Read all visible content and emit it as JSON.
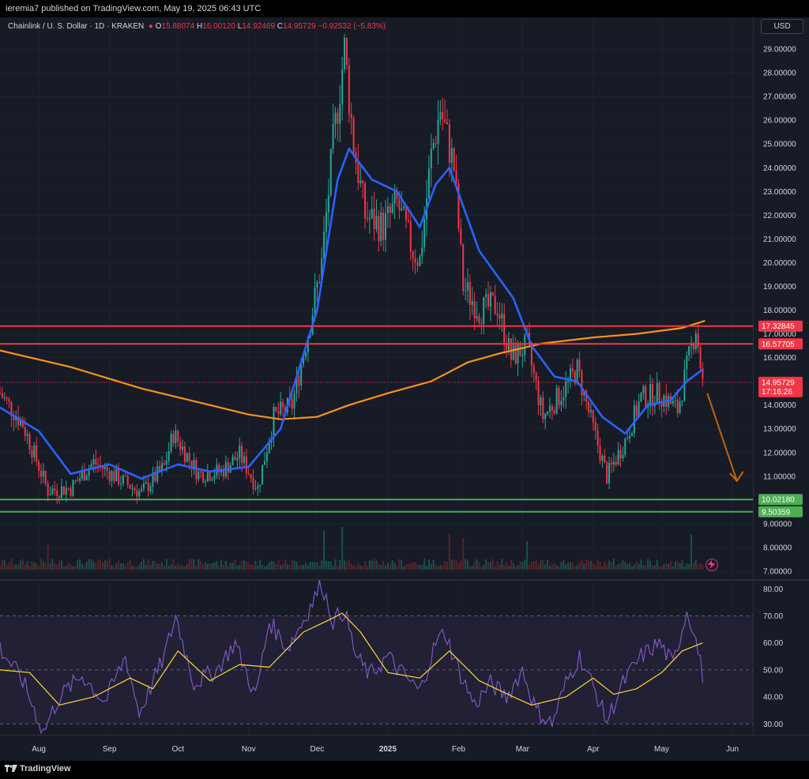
{
  "header": {
    "published": "ieremia7 published on TradingView.com, May 19, 2025 06:43 UTC"
  },
  "symbol_legend": {
    "name": "Chainlink / U. S. Dollar · 1D · KRAKEN",
    "open_label": "O",
    "open": "15.88074",
    "high_label": "H",
    "high": "16.00120",
    "low_label": "L",
    "low": "14.92469",
    "close_label": "C",
    "close": "14.95729",
    "change": "−0.92532 (−5.83%)"
  },
  "currency_button": "USD",
  "footer": {
    "brand": "TradingView"
  },
  "colors": {
    "bull": "#26a69a",
    "bear": "#f23645",
    "ema_fast": "#2962ff",
    "ema_slow": "#f7931a",
    "resistance": "#f23645",
    "support": "#4caf50",
    "rsi": "#7e57c2",
    "rsi_ma": "#fdd835",
    "arrow": "#c0650a"
  },
  "chart_data": [
    {
      "type": "candlestick",
      "title": "Chainlink / U. S. Dollar · 1D · KRAKEN",
      "ylim": [
        7.0,
        30.0
      ],
      "y_ticks": [
        "29.00000",
        "28.00000",
        "27.00000",
        "26.00000",
        "25.00000",
        "24.00000",
        "23.00000",
        "22.00000",
        "21.00000",
        "20.00000",
        "19.00000",
        "18.00000",
        "17.00000",
        "16.00000",
        "14.00000",
        "13.00000",
        "12.00000",
        "11.00000",
        "9.00000",
        "8.00000",
        "7.00000"
      ],
      "x_ticks": [
        "Aug",
        "Sep",
        "Oct",
        "Nov",
        "Dec",
        "2025",
        "Feb",
        "Mar",
        "Apr",
        "May",
        "Jun"
      ],
      "x_tick_dates": [
        "2024-08-01",
        "2024-09-01",
        "2024-10-01",
        "2024-11-01",
        "2024-12-01",
        "2025-01-01",
        "2025-02-01",
        "2025-03-01",
        "2025-04-01",
        "2025-05-01",
        "2025-06-01"
      ],
      "x_range": [
        "2024-07-15",
        "2025-06-10"
      ],
      "price_path": [
        [
          "2024-07-15",
          14.5
        ],
        [
          "2024-07-25",
          13.2
        ],
        [
          "2024-08-05",
          10.4
        ],
        [
          "2024-08-15",
          10.5
        ],
        [
          "2024-08-25",
          11.6
        ],
        [
          "2024-09-05",
          10.9
        ],
        [
          "2024-09-15",
          10.3
        ],
        [
          "2024-09-25",
          11.4
        ],
        [
          "2024-09-29",
          12.8
        ],
        [
          "2024-10-10",
          11.1
        ],
        [
          "2024-10-20",
          11.2
        ],
        [
          "2024-10-28",
          11.9
        ],
        [
          "2024-11-05",
          10.5
        ],
        [
          "2024-11-12",
          13.5
        ],
        [
          "2024-11-20",
          14.0
        ],
        [
          "2024-11-28",
          17.5
        ],
        [
          "2024-12-03",
          20.0
        ],
        [
          "2024-12-08",
          25.0
        ],
        [
          "2024-12-13",
          29.0
        ],
        [
          "2024-12-17",
          25.0
        ],
        [
          "2024-12-22",
          22.0
        ],
        [
          "2024-12-30",
          21.5
        ],
        [
          "2025-01-05",
          22.5
        ],
        [
          "2025-01-12",
          20.5
        ],
        [
          "2025-01-15",
          20.1
        ],
        [
          "2025-01-20",
          24.5
        ],
        [
          "2025-01-24",
          26.5
        ],
        [
          "2025-01-30",
          24.0
        ],
        [
          "2025-02-03",
          19.0
        ],
        [
          "2025-02-10",
          18.0
        ],
        [
          "2025-02-18",
          18.2
        ],
        [
          "2025-02-24",
          16.0
        ],
        [
          "2025-03-03",
          16.5
        ],
        [
          "2025-03-10",
          13.5
        ],
        [
          "2025-03-18",
          14.5
        ],
        [
          "2025-03-25",
          15.5
        ],
        [
          "2025-04-01",
          13.0
        ],
        [
          "2025-04-07",
          11.0
        ],
        [
          "2025-04-15",
          12.5
        ],
        [
          "2025-04-22",
          14.3
        ],
        [
          "2025-04-30",
          14.5
        ],
        [
          "2025-05-08",
          13.8
        ],
        [
          "2025-05-13",
          16.0
        ],
        [
          "2025-05-16",
          17.3
        ],
        [
          "2025-05-19",
          14.95
        ]
      ],
      "ema_fast_path": [
        [
          "2024-07-15",
          13.9
        ],
        [
          "2024-08-01",
          12.9
        ],
        [
          "2024-08-15",
          11.1
        ],
        [
          "2024-09-01",
          11.5
        ],
        [
          "2024-09-15",
          10.9
        ],
        [
          "2024-10-01",
          11.5
        ],
        [
          "2024-10-15",
          11.2
        ],
        [
          "2024-11-01",
          11.4
        ],
        [
          "2024-11-15",
          13.0
        ],
        [
          "2024-12-01",
          18.0
        ],
        [
          "2024-12-10",
          23.5
        ],
        [
          "2024-12-15",
          24.8
        ],
        [
          "2024-12-25",
          23.5
        ],
        [
          "2025-01-05",
          23.0
        ],
        [
          "2025-01-15",
          21.5
        ],
        [
          "2025-01-22",
          23.3
        ],
        [
          "2025-01-28",
          24.0
        ],
        [
          "2025-02-10",
          20.5
        ],
        [
          "2025-02-25",
          18.5
        ],
        [
          "2025-03-05",
          16.5
        ],
        [
          "2025-03-15",
          15.2
        ],
        [
          "2025-03-25",
          15.0
        ],
        [
          "2025-04-05",
          13.5
        ],
        [
          "2025-04-15",
          12.8
        ],
        [
          "2025-04-25",
          14.0
        ],
        [
          "2025-05-05",
          14.2
        ],
        [
          "2025-05-12",
          15.0
        ],
        [
          "2025-05-19",
          15.5
        ]
      ],
      "ema_slow_path": [
        [
          "2024-07-15",
          16.3
        ],
        [
          "2024-08-15",
          15.6
        ],
        [
          "2024-09-15",
          14.7
        ],
        [
          "2024-10-15",
          14.0
        ],
        [
          "2024-11-01",
          13.6
        ],
        [
          "2024-11-15",
          13.4
        ],
        [
          "2024-12-01",
          13.5
        ],
        [
          "2024-12-15",
          14.0
        ],
        [
          "2025-01-01",
          14.5
        ],
        [
          "2025-01-20",
          15.0
        ],
        [
          "2025-02-05",
          15.8
        ],
        [
          "2025-02-20",
          16.2
        ],
        [
          "2025-03-10",
          16.6
        ],
        [
          "2025-04-01",
          16.85
        ],
        [
          "2025-04-20",
          17.0
        ],
        [
          "2025-05-10",
          17.25
        ],
        [
          "2025-05-20",
          17.55
        ]
      ],
      "horizontal_levels": [
        {
          "label": "17.32845",
          "value": 17.32845,
          "kind": "resistance"
        },
        {
          "label": "16.57705",
          "value": 16.57705,
          "kind": "resistance"
        },
        {
          "label": "10.02180",
          "value": 10.0218,
          "kind": "support"
        },
        {
          "label": "9.50359",
          "value": 9.50359,
          "kind": "support"
        }
      ],
      "last_price": {
        "label": "14.95729",
        "countdown": "17:16:26",
        "value": 14.95729
      },
      "arrow": {
        "from": [
          "2025-05-21",
          14.5
        ],
        "to": [
          "2025-06-03",
          10.8
        ]
      },
      "volume": {
        "scale_max": 1.0,
        "spikes": [
          [
            "2024-08-05",
            0.35
          ],
          [
            "2024-12-04",
            0.55
          ],
          [
            "2024-12-12",
            0.6
          ],
          [
            "2025-01-28",
            0.5
          ],
          [
            "2025-02-03",
            0.45
          ],
          [
            "2025-03-03",
            0.4
          ],
          [
            "2025-05-14",
            0.5
          ]
        ]
      }
    },
    {
      "type": "line",
      "title": "RSI",
      "ylim": [
        26.0,
        83.0
      ],
      "y_ticks": [
        "80.00",
        "70.00",
        "60.00",
        "50.00",
        "40.00",
        "30.00"
      ],
      "bands": [
        30,
        50,
        70
      ],
      "rsi_path": [
        [
          "2024-07-15",
          58
        ],
        [
          "2024-07-25",
          46
        ],
        [
          "2024-08-03",
          27
        ],
        [
          "2024-08-10",
          40
        ],
        [
          "2024-08-20",
          48
        ],
        [
          "2024-08-30",
          38
        ],
        [
          "2024-09-08",
          55
        ],
        [
          "2024-09-14",
          34
        ],
        [
          "2024-09-25",
          55
        ],
        [
          "2024-09-30",
          70
        ],
        [
          "2024-10-08",
          45
        ],
        [
          "2024-10-18",
          50
        ],
        [
          "2024-10-26",
          60
        ],
        [
          "2024-11-04",
          40
        ],
        [
          "2024-11-10",
          68
        ],
        [
          "2024-11-18",
          58
        ],
        [
          "2024-11-26",
          70
        ],
        [
          "2024-12-03",
          82
        ],
        [
          "2024-12-08",
          68
        ],
        [
          "2024-12-13",
          72
        ],
        [
          "2024-12-18",
          55
        ],
        [
          "2024-12-24",
          48
        ],
        [
          "2025-01-01",
          55
        ],
        [
          "2025-01-08",
          48
        ],
        [
          "2025-01-15",
          42
        ],
        [
          "2025-01-22",
          60
        ],
        [
          "2025-01-26",
          64
        ],
        [
          "2025-02-01",
          50
        ],
        [
          "2025-02-08",
          37
        ],
        [
          "2025-02-15",
          45
        ],
        [
          "2025-02-22",
          40
        ],
        [
          "2025-03-01",
          50
        ],
        [
          "2025-03-07",
          35
        ],
        [
          "2025-03-14",
          30
        ],
        [
          "2025-03-20",
          45
        ],
        [
          "2025-03-26",
          55
        ],
        [
          "2025-04-02",
          42
        ],
        [
          "2025-04-07",
          31
        ],
        [
          "2025-04-14",
          45
        ],
        [
          "2025-04-22",
          55
        ],
        [
          "2025-04-30",
          60
        ],
        [
          "2025-05-06",
          52
        ],
        [
          "2025-05-12",
          72
        ],
        [
          "2025-05-15",
          65
        ],
        [
          "2025-05-19",
          48
        ]
      ],
      "rsi_ma_path": [
        [
          "2024-07-15",
          50
        ],
        [
          "2024-07-28",
          49
        ],
        [
          "2024-08-10",
          37
        ],
        [
          "2024-08-25",
          40
        ],
        [
          "2024-09-10",
          47
        ],
        [
          "2024-09-20",
          43
        ],
        [
          "2024-10-01",
          57
        ],
        [
          "2024-10-15",
          46
        ],
        [
          "2024-10-28",
          52
        ],
        [
          "2024-11-10",
          51
        ],
        [
          "2024-11-25",
          64
        ],
        [
          "2024-12-05",
          68
        ],
        [
          "2024-12-12",
          71
        ],
        [
          "2024-12-20",
          64
        ],
        [
          "2025-01-01",
          49
        ],
        [
          "2025-01-15",
          47
        ],
        [
          "2025-01-28",
          57
        ],
        [
          "2025-02-10",
          46
        ],
        [
          "2025-02-25",
          40
        ],
        [
          "2025-03-05",
          37
        ],
        [
          "2025-03-20",
          40
        ],
        [
          "2025-04-01",
          47
        ],
        [
          "2025-04-10",
          41
        ],
        [
          "2025-04-20",
          43
        ],
        [
          "2025-05-01",
          49
        ],
        [
          "2025-05-10",
          57
        ],
        [
          "2025-05-19",
          60
        ]
      ]
    }
  ]
}
